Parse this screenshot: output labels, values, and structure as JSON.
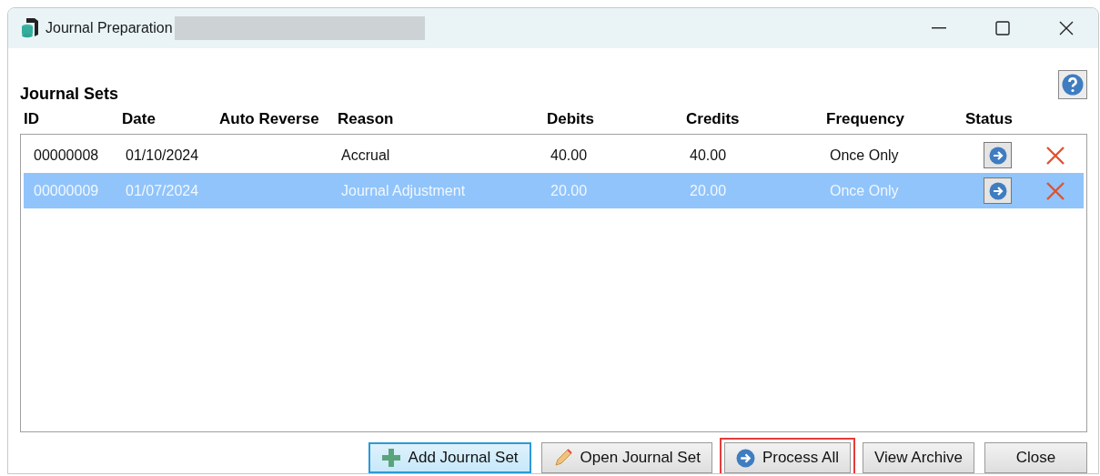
{
  "window": {
    "title": "Journal Preparation"
  },
  "section": {
    "heading": "Journal Sets"
  },
  "table": {
    "columns": [
      "ID",
      "Date",
      "Auto Reverse",
      "Reason",
      "Debits",
      "Credits",
      "Frequency",
      "Status"
    ],
    "rows": [
      {
        "id": "00000008",
        "date": "01/10/2024",
        "reason": "Accrual",
        "debits": "40.00",
        "credits": "40.00",
        "frequency": "Once Only",
        "selected": false
      },
      {
        "id": "00000009",
        "date": "01/07/2024",
        "reason": "Journal Adjustment",
        "debits": "20.00",
        "credits": "20.00",
        "frequency": "Once Only",
        "selected": true
      }
    ]
  },
  "buttons": [
    {
      "label": "Add Journal Set",
      "kind": "plus",
      "focused": true,
      "outlined": false
    },
    {
      "label": "Open Journal Set",
      "kind": "pencil",
      "focused": false,
      "outlined": false
    },
    {
      "label": "Process All",
      "kind": "arrow",
      "focused": false,
      "outlined": true
    },
    {
      "label": "View Archive",
      "kind": "plain",
      "focused": false,
      "outlined": false
    },
    {
      "label": "Close",
      "kind": "plain",
      "focused": false,
      "outlined": false
    }
  ]
}
